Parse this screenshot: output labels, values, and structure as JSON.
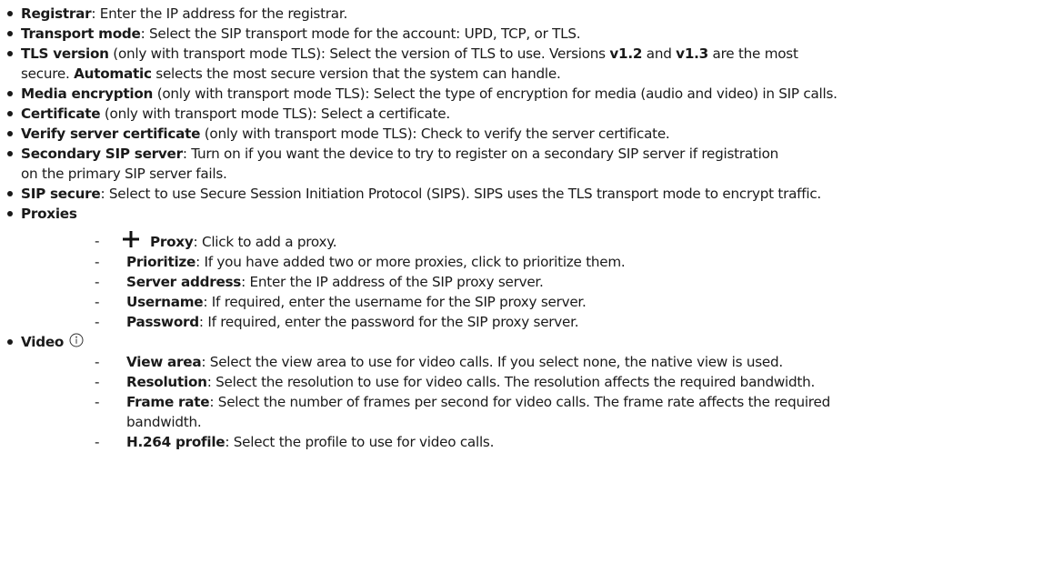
{
  "items": {
    "registrar": {
      "term": "Registrar",
      "text": ": Enter the IP address for the registrar."
    },
    "transport": {
      "term": "Transport mode",
      "text": ": Select the SIP transport mode for the account: UPD, TCP, or TLS."
    },
    "tls_version": {
      "term": "TLS version",
      "text1": " (only with transport mode TLS): Select the version of TLS to use. Versions ",
      "v12": "v1.2",
      "and": " and ",
      "v13": "v1.3",
      "text2": " are the most",
      "line2_prefix": "secure. ",
      "automatic": "Automatic",
      "line2_text": " selects the most secure version that the system can handle."
    },
    "media_encryption": {
      "term": "Media encryption",
      "text": " (only with transport mode TLS): Select the type of encryption for media (audio and video) in SIP calls."
    },
    "certificate": {
      "term": "Certificate",
      "text": " (only with transport mode TLS): Select a certificate."
    },
    "verify": {
      "term": "Verify server certificate",
      "text": " (only with transport mode TLS): Check to verify the server certificate."
    },
    "secondary": {
      "term": "Secondary SIP server",
      "text1": ": Turn on if you want the device to try to register on a secondary SIP server if registration",
      "text2": "on the primary SIP server fails."
    },
    "sip_secure": {
      "term": "SIP secure",
      "text": ": Select to use Secure Session Initiation Protocol (SIPS). SIPS uses the TLS transport mode to encrypt traffic."
    },
    "proxies": {
      "term": "Proxies",
      "dash": "-",
      "sub": [
        {
          "term": "Proxy",
          "text": ": Click to add a proxy."
        },
        {
          "term": "Prioritize",
          "text": ": If you have added two or more proxies, click to prioritize them."
        },
        {
          "term": "Server address",
          "text": ": Enter the IP address of the SIP proxy server."
        },
        {
          "term": "Username",
          "text": ": If required, enter the username for the SIP proxy server."
        },
        {
          "term": "Password",
          "text": ": If required, enter the password for the SIP proxy server."
        }
      ]
    },
    "video": {
      "term": "Video",
      "sub": [
        {
          "term": "View area",
          "text": ": Select the view area to use for video calls. If you select none, the native view is used."
        },
        {
          "term": "Resolution",
          "text": ": Select the resolution to use for video calls. The resolution affects the required bandwidth."
        },
        {
          "term": "Frame rate",
          "text": ": Select the number of frames per second for video calls. The frame rate affects the required",
          "cont": "bandwidth."
        },
        {
          "term": "H.264 profile",
          "text": ": Select the profile to use for video calls."
        }
      ]
    }
  },
  "icons": {
    "add": "plus-icon",
    "info": "info-icon"
  }
}
